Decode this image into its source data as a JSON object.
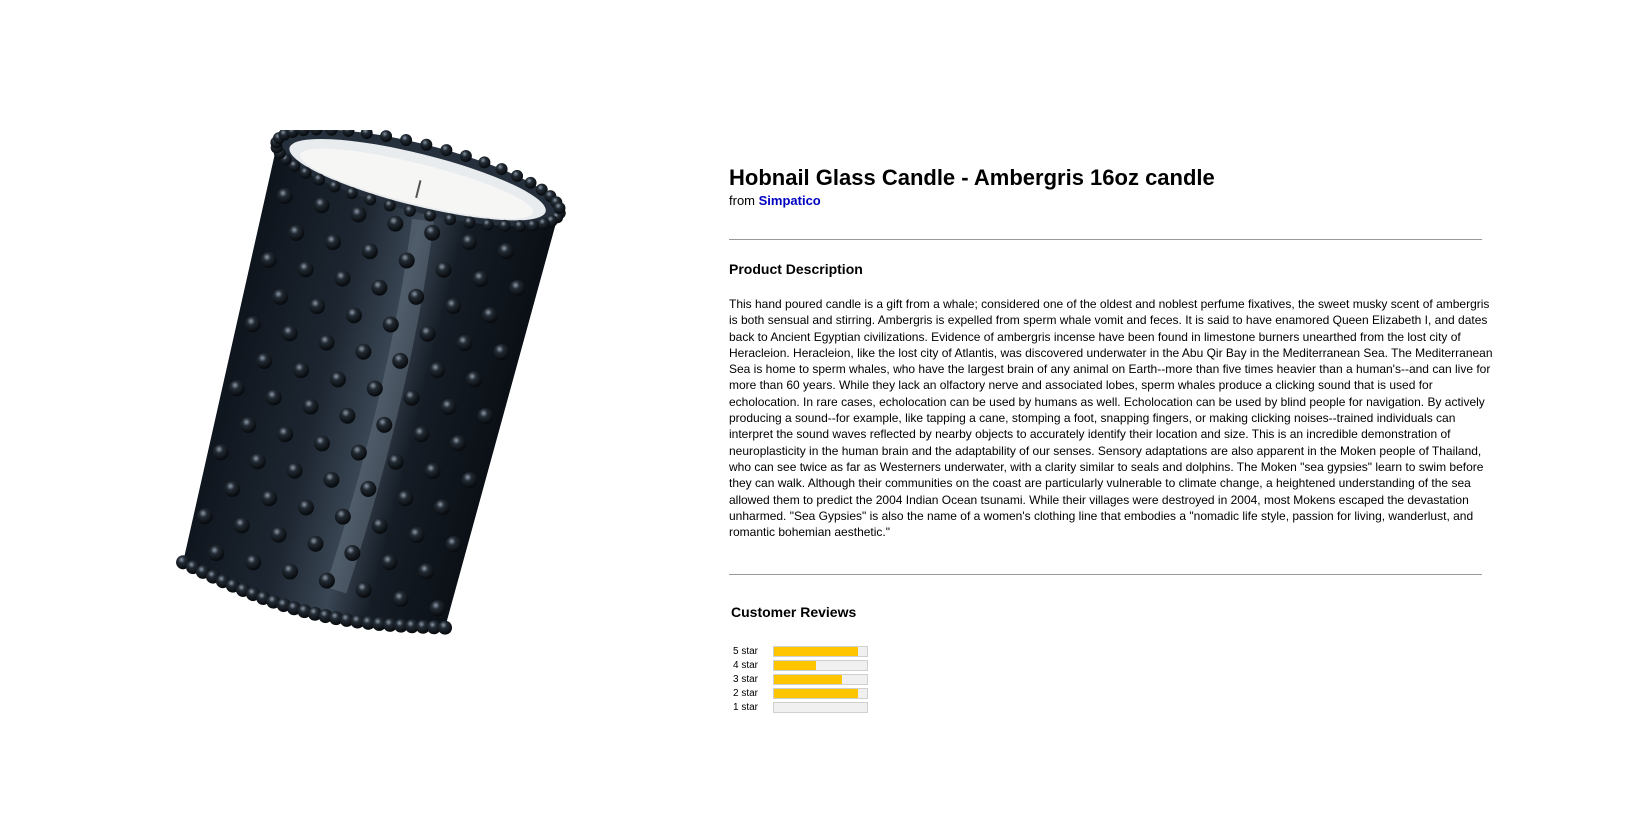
{
  "product": {
    "title": "Hobnail Glass Candle - Ambergris 16oz candle",
    "from_prefix": "from ",
    "brand": "Simpatico",
    "image_icon": "hobnail-candle-image"
  },
  "description": {
    "heading": "Product Description",
    "text": "This hand poured candle is a gift from a whale; considered one of the oldest and noblest perfume fixatives, the sweet musky scent of ambergris is both sensual and stirring. Ambergris is expelled from sperm whale vomit and feces. It is said to have enamored Queen Elizabeth I, and dates back to Ancient Egyptian civilizations. Evidence of ambergris incense have been found in limestone burners unearthed from the lost city of Heracleion. Heracleion, like the lost city of Atlantis, was discovered underwater in the Abu Qir Bay in the Mediterranean Sea. The Mediterranean Sea is home to sperm whales, who have the largest brain of any animal on Earth--more than five times heavier than a human's--and can live for more than 60 years. While they lack an olfactory nerve and associated lobes, sperm whales produce a clicking sound that is used for echolocation. In rare cases, echolocation can be used by humans as well. Echolocation can be used by blind people for navigation.  By actively producing a sound--for example, like tapping a cane, stomping a foot, snapping fingers, or making clicking noises--trained individuals can interpret the sound waves reflected by nearby objects to accurately identify their location and size. This is an incredible demonstration of neuroplasticity in the human brain and the adaptability of our senses. Sensory adaptations are also apparent in the Moken people of Thailand, who can see twice as far as Westerners underwater, with a clarity similar to seals and dolphins. The Moken \"sea gypsies\" learn to swim before they can walk. Although their communities on the coast are particularly vulnerable to climate change, a heightened understanding of the sea allowed them to predict the 2004 Indian Ocean tsunami. While their villages were destroyed in 2004, most Mokens escaped the devastation unharmed. \"Sea Gypsies\" is also the name of a women's clothing line that embodies a \"nomadic life style, passion for living, wanderlust, and romantic bohemian aesthetic.\""
  },
  "reviews": {
    "heading": "Customer Reviews",
    "bar_color": "#ffc600",
    "ratings": [
      {
        "label": "5 star",
        "fraction": 0.9
      },
      {
        "label": "4 star",
        "fraction": 0.45
      },
      {
        "label": "3 star",
        "fraction": 0.73
      },
      {
        "label": "2 star",
        "fraction": 0.9
      },
      {
        "label": "1 star",
        "fraction": 0.0
      }
    ]
  }
}
